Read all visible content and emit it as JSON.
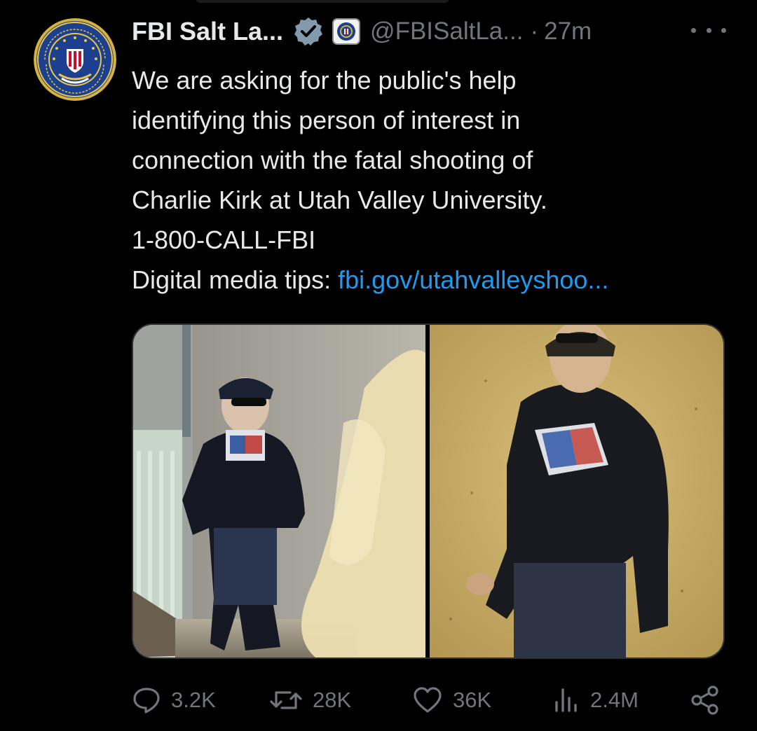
{
  "tweet": {
    "display_name": "FBI Salt La...",
    "handle": "@FBISaltLa...",
    "separator": "·",
    "time": "27m",
    "text_lines": [
      "We are asking for the public's help",
      "identifying this person of interest in",
      "connection with the fatal shooting of",
      "Charlie Kirk at Utah Valley University.",
      "1-800-CALL-FBI"
    ],
    "tips_label": "Digital media tips:",
    "link_text": "fbi.gov/utahvalleyshoo..."
  },
  "actions": {
    "replies": "3.2K",
    "reposts": "28K",
    "likes": "36K",
    "views": "2.4M"
  },
  "colors": {
    "background": "#000000",
    "text": "#e7e9ea",
    "muted": "#71767b",
    "link": "#1d9bf0",
    "verified": "#829aab"
  },
  "icons": {
    "avatar": "fbi-seal",
    "verified": "verified-badge-icon",
    "affiliate": "fbi-affiliate-badge-icon",
    "more": "more-options-icon",
    "reply": "reply-icon",
    "repost": "repost-icon",
    "like": "heart-icon",
    "views": "views-bar-chart-icon",
    "share": "share-icon"
  }
}
